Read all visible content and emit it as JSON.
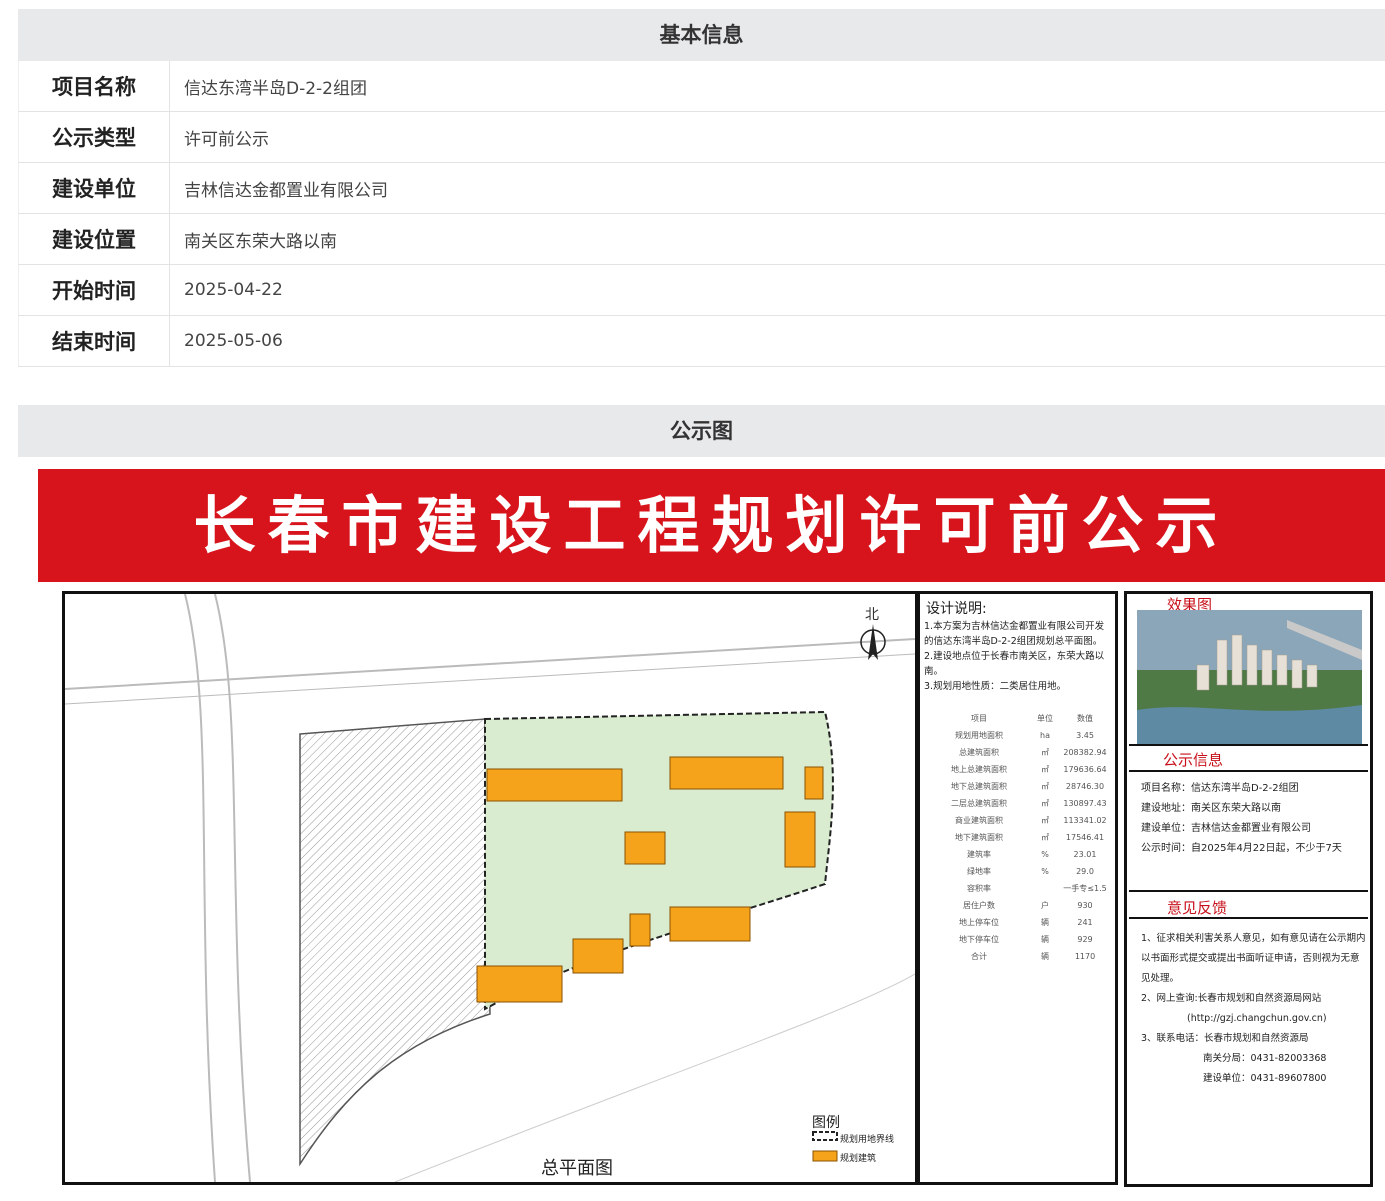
{
  "sections": {
    "basic_info": "基本信息",
    "notice_map": "公示图"
  },
  "info_rows": [
    {
      "label": "项目名称",
      "value": "信达东湾半岛D-2-2组团"
    },
    {
      "label": "公示类型",
      "value": "许可前公示"
    },
    {
      "label": "建设单位",
      "value": "吉林信达金都置业有限公司"
    },
    {
      "label": "建设位置",
      "value": "南关区东荣大路以南"
    },
    {
      "label": "开始时间",
      "value": "2025-04-22"
    },
    {
      "label": "结束时间",
      "value": "2025-05-06"
    }
  ],
  "poster": {
    "banner": "长春市建设工程规划许可前公示",
    "site_plan_title": "总平面图",
    "north": "北",
    "legend_title": "图例",
    "legend_items": [
      "规划用地界线",
      "规划建筑"
    ],
    "design_title": "设计说明:",
    "design_lines": [
      "1.本方案为吉林信达金都置业有限公司开发",
      "的信达东湾半岛D-2-2组团规划总平面图。",
      "2.建设地点位于长春市南关区，东荣大路以",
      "南。",
      "3.规划用地性质：二类居住用地。"
    ],
    "tech_table": [
      {
        "k": "项目",
        "u": "单位",
        "v": "数值"
      },
      {
        "k": "规划用地面积",
        "u": "ha",
        "v": "3.45"
      },
      {
        "k": "总建筑面积",
        "u": "㎡",
        "v": "208382.94"
      },
      {
        "k": "地上总建筑面积",
        "u": "㎡",
        "v": "179636.64"
      },
      {
        "k": "地下总建筑面积",
        "u": "㎡",
        "v": "28746.30"
      },
      {
        "k": "二层总建筑面积",
        "u": "㎡",
        "v": "130897.43"
      },
      {
        "k": "商业建筑面积",
        "u": "㎡",
        "v": "113341.02"
      },
      {
        "k": "地下建筑面积",
        "u": "㎡",
        "v": "17546.41"
      },
      {
        "k": "建筑率",
        "u": "%",
        "v": "23.01"
      },
      {
        "k": "绿地率",
        "u": "%",
        "v": "29.0"
      },
      {
        "k": "容积率",
        "u": "",
        "v": "一手专≤1.5"
      },
      {
        "k": "居住户数",
        "u": "户",
        "v": "930"
      },
      {
        "k": "地上停车位",
        "u": "辆",
        "v": "241"
      },
      {
        "k": "地下停车位",
        "u": "辆",
        "v": "929"
      },
      {
        "k": "合计",
        "u": "辆",
        "v": "1170"
      }
    ],
    "effect_title": "效果图",
    "info_title": "公示信息",
    "info_lines": [
      "项目名称：信达东湾半岛D-2-2组团",
      "建设地址：南关区东荣大路以南",
      "建设单位：吉林信达金都置业有限公司",
      "公示时间：自2025年4月22日起，不少于7天"
    ],
    "feedback_title": "意见反馈",
    "feedback_lines": [
      "1、征求相关利害关系人意见，如有意见请在公示期内",
      "以书面形式提交或提出书面听证申请，否则视为无意",
      "见处理。",
      "2、网上查询:长春市规划和自然资源局网站",
      "(http://gzj.changchun.gov.cn)",
      "3、联系电话：长春市规划和自然资源局",
      "南关分局：0431-82003368",
      "建设单位：0431-89607800"
    ],
    "colors": {
      "banner": "#d7141c",
      "building": "#f5a31a",
      "green": "#d9ecd0",
      "title_red": "#c8101a"
    }
  }
}
